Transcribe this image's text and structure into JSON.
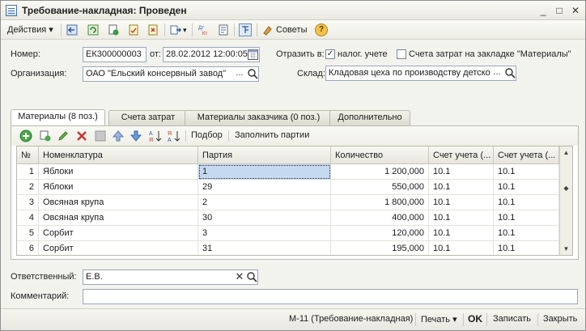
{
  "window": {
    "title": "Требование-накладная: Проведен",
    "controls": {
      "minimize": "_",
      "maximize": "□",
      "close": "✕"
    }
  },
  "toolbar": {
    "actions_label": "Действия",
    "tips_label": "Советы",
    "help_symbol": "?"
  },
  "header": {
    "number_label": "Номер:",
    "number_value": "ЕК300000003",
    "date_label": "от:",
    "date_value": "28.02.2012 12:00:05",
    "reflect_label": "Отразить в:",
    "tax_accounting_label": "налог. учете",
    "tax_accounting_checked": true,
    "cost_accounts_label": "Счета затрат на закладке \"Материалы\"",
    "cost_accounts_checked": false,
    "org_label": "Организация:",
    "org_value": "ОАО \"Ельский консервный завод\"",
    "warehouse_label": "Склад:",
    "warehouse_value": "Кладовая цеха по производству детско"
  },
  "tabs": [
    {
      "label": "Материалы (8 поз.)",
      "active": true
    },
    {
      "label": "Счета затрат",
      "active": false
    },
    {
      "label": "Материалы заказчика (0 поз.)",
      "active": false
    },
    {
      "label": "Дополнительно",
      "active": false
    }
  ],
  "table_toolbar": {
    "selection_label": "Подбор",
    "fill_batches_label": "Заполнить партии"
  },
  "table": {
    "columns": [
      "№",
      "Номенклатура",
      "Партия",
      "Количество",
      "Счет учета (...",
      "Счет учета (..."
    ],
    "rows": [
      {
        "n": "1",
        "item": "Яблоки",
        "batch": "1",
        "qty": "1 200,000",
        "acc1": "10.1",
        "acc2": "10.1"
      },
      {
        "n": "2",
        "item": "Яблоки",
        "batch": "29",
        "qty": "550,000",
        "acc1": "10.1",
        "acc2": "10.1"
      },
      {
        "n": "3",
        "item": "Овсяная крупа",
        "batch": "2",
        "qty": "1 800,000",
        "acc1": "10.1",
        "acc2": "10.1"
      },
      {
        "n": "4",
        "item": "Овсяная крупа",
        "batch": "30",
        "qty": "400,000",
        "acc1": "10.1",
        "acc2": "10.1"
      },
      {
        "n": "5",
        "item": "Сорбит",
        "batch": "3",
        "qty": "120,000",
        "acc1": "10.1",
        "acc2": "10.1"
      },
      {
        "n": "6",
        "item": "Сорбит",
        "batch": "31",
        "qty": "195,000",
        "acc1": "10.1",
        "acc2": "10.1"
      }
    ]
  },
  "responsible": {
    "label": "Ответственный:",
    "value": "Е.В."
  },
  "comment": {
    "label": "Комментарий:",
    "value": ""
  },
  "footer": {
    "form_label": "М-11 (Требование-накладная)",
    "print_label": "Печать",
    "ok_label": "OK",
    "save_label": "Записать",
    "close_label": "Закрыть"
  },
  "icons": {
    "field_select": "...",
    "field_search": "search-icon",
    "field_clear": "✕",
    "calendar": "calendar-icon"
  },
  "colors": {
    "selection": "#c5d9f1",
    "window_bg": "#f3f3ee",
    "border": "#9aa6b8"
  }
}
